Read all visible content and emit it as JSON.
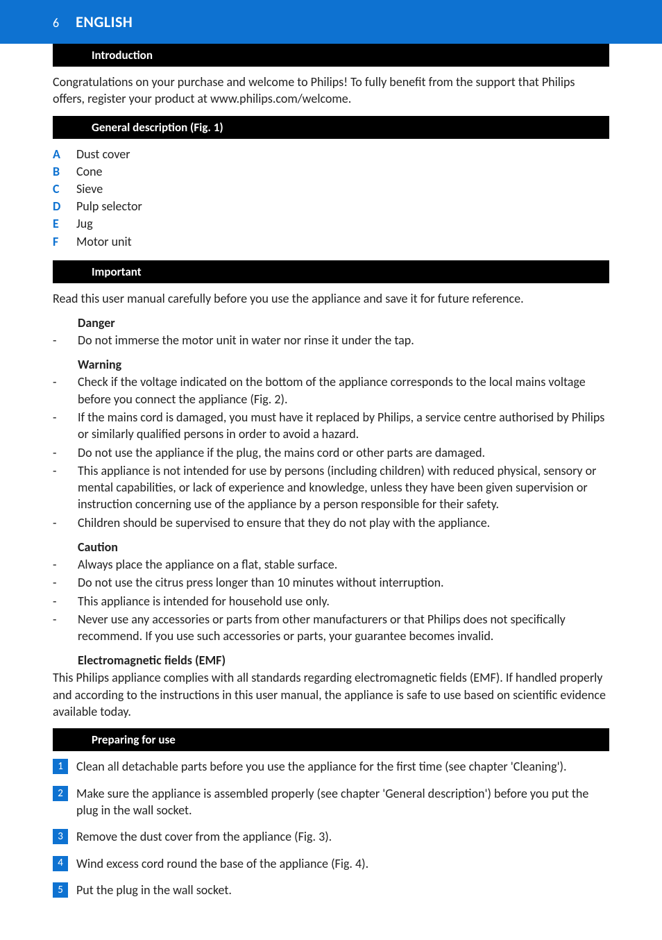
{
  "header": {
    "pageNumber": "6",
    "language": "ENGLISH"
  },
  "sections": {
    "intro": {
      "title": "Introduction",
      "body": "Congratulations on your purchase and welcome to Philips! To fully benefit from the support that Philips offers, register your product at www.philips.com/welcome."
    },
    "general": {
      "title": "General description (Fig. 1)",
      "items": [
        {
          "letter": "A",
          "text": "Dust cover"
        },
        {
          "letter": "B",
          "text": "Cone"
        },
        {
          "letter": "C",
          "text": "Sieve"
        },
        {
          "letter": "D",
          "text": "Pulp selector"
        },
        {
          "letter": "E",
          "text": "Jug"
        },
        {
          "letter": "F",
          "text": "Motor unit"
        }
      ]
    },
    "important": {
      "title": "Important",
      "body": "Read this user manual carefully before you use the appliance and save it for future reference.",
      "danger": {
        "title": "Danger",
        "items": [
          "Do not immerse the motor unit in water nor rinse it under the tap."
        ]
      },
      "warning": {
        "title": "Warning",
        "items": [
          "Check if the voltage indicated on the bottom of the appliance corresponds to the local mains voltage before you connect the appliance (Fig. 2).",
          "If the mains cord is damaged, you must have it replaced by Philips, a service centre authorised by Philips or similarly qualified persons in order to avoid a hazard.",
          "Do not use the appliance if the plug, the mains cord or other parts are damaged.",
          "This appliance is not intended for use by persons (including children) with reduced physical, sensory or mental capabilities, or lack of experience and knowledge, unless they have been given supervision or instruction concerning use of the appliance by a person responsible for their safety.",
          "Children should be supervised to ensure that they do not play with the appliance."
        ]
      },
      "caution": {
        "title": "Caution",
        "items": [
          "Always place the appliance on a flat, stable surface.",
          "Do not use the citrus press longer than 10 minutes without interruption.",
          "This appliance is intended for household use only.",
          "Never use any accessories or parts from other manufacturers or that Philips does not specifically recommend. If you use such accessories or parts, your guarantee becomes invalid."
        ]
      },
      "emf": {
        "title": "Electromagnetic fields (EMF)",
        "body": "This Philips appliance complies with all standards regarding electromagnetic fields (EMF). If handled properly and according to the instructions in this user manual, the appliance is safe to use based on scientific evidence available today."
      }
    },
    "preparing": {
      "title": "Preparing for use",
      "steps": [
        "Clean all detachable parts before you use the appliance for the first time (see chapter 'Cleaning').",
        "Make sure the appliance is assembled properly (see chapter 'General description') before you put the plug in the wall socket.",
        "Remove the dust cover from the appliance (Fig. 3).",
        "Wind excess cord round the base of the appliance (Fig. 4).",
        "Put the plug in the wall socket."
      ]
    }
  }
}
